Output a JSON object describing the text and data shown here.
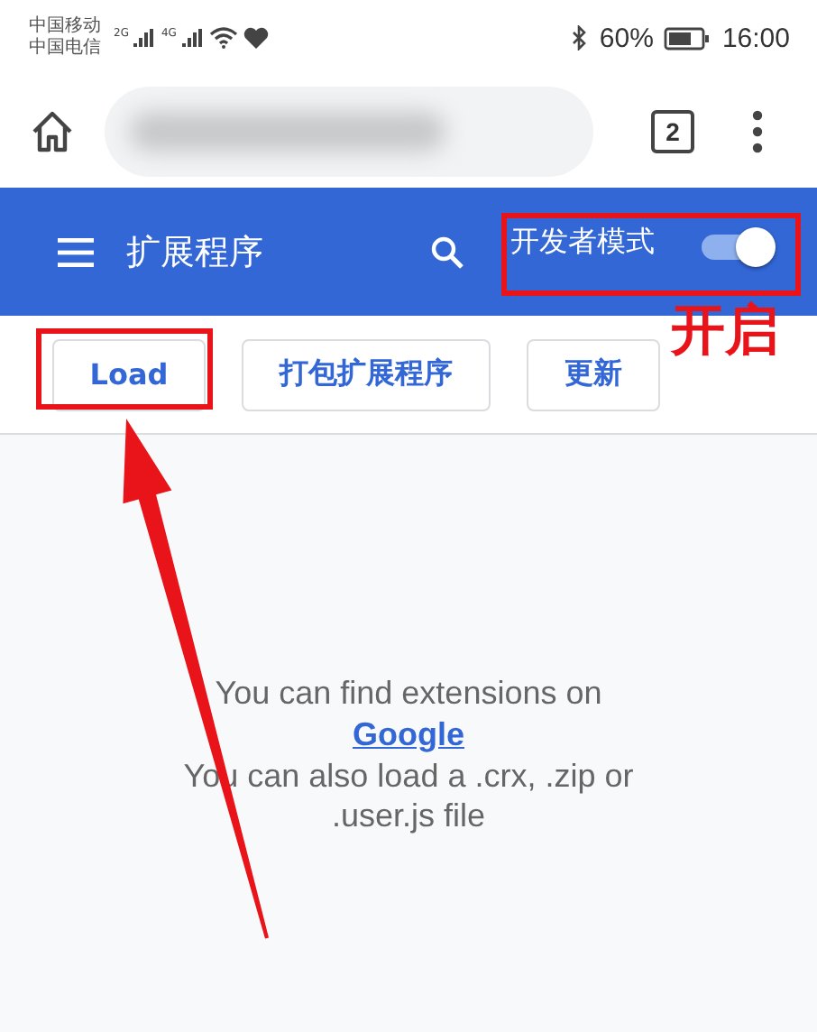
{
  "status_bar": {
    "carriers": [
      "中国移动",
      "中国电信"
    ],
    "network_labels": [
      "2G",
      "4G"
    ],
    "battery": "60%",
    "time": "16:00"
  },
  "browser": {
    "tab_count": "2"
  },
  "header": {
    "title": "扩展程序",
    "developer_mode": {
      "label": "开发者模式",
      "on": true
    }
  },
  "buttons": [
    "Load",
    "打包扩展程序",
    "更新"
  ],
  "empty_state": {
    "line_1": "You can find extensions on",
    "link": "Google",
    "line_2": "You can also load a .crx, .zip or .user.js file"
  },
  "annotations": {
    "callout": "开启"
  }
}
